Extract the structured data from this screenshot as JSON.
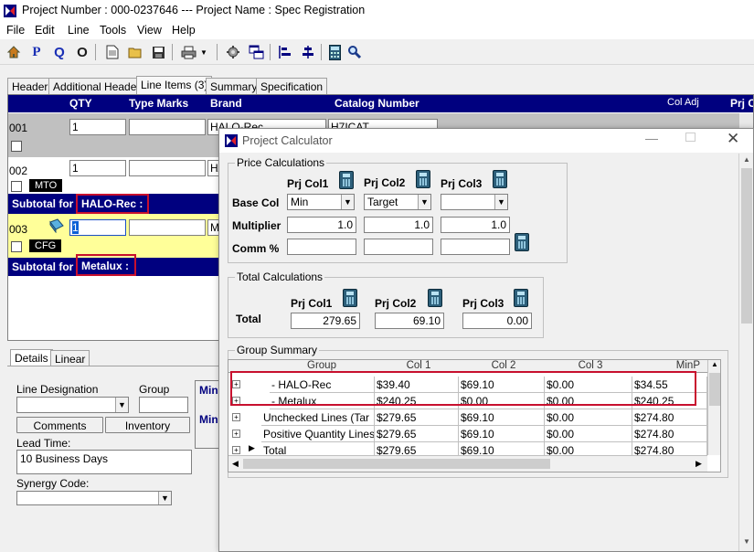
{
  "window": {
    "title": "Project Number : 000-0237646 --- Project Name : Spec Registration"
  },
  "menu": [
    "File",
    "Edit",
    "Line",
    "Tools",
    "View",
    "Help"
  ],
  "toolbar": {
    "icons": [
      "home-icon",
      "p-icon",
      "q-icon",
      "o-icon",
      "new-icon",
      "open-icon",
      "save-icon",
      "print-icon",
      "dropdown-icon",
      "gear-icon",
      "windows-icon",
      "align-left-icon",
      "align-center-icon",
      "calculator-icon",
      "search-icon"
    ],
    "p_label": "P",
    "q_label": "Q",
    "o_label": "O"
  },
  "tabs": [
    "Header",
    "Additional Header",
    "Line Items (3)",
    "Summary",
    "Specification"
  ],
  "grid": {
    "headers": [
      "QTY",
      "Type Marks",
      "Brand",
      "Catalog Number",
      "Col Adj",
      "Prj C"
    ],
    "rows": [
      {
        "num": "001",
        "qty": "1",
        "type_marks": "",
        "brand": "HALO-Rec",
        "catalog": "H7ICAT"
      },
      {
        "num": "002",
        "qty": "1",
        "type_marks": "",
        "brand": "HA",
        "tag": "MTO"
      },
      {
        "num": "003",
        "qty": "1",
        "type_marks": "",
        "brand": "Me",
        "tag": "CFG"
      }
    ],
    "subtotals": [
      {
        "label": "Subtotal for",
        "name": "HALO-Rec :"
      },
      {
        "label": "Subtotal for",
        "name": "Metalux :"
      }
    ]
  },
  "bottom": {
    "tabs": [
      "Details",
      "Linear"
    ],
    "line_designation_label": "Line Designation",
    "group_label": "Group",
    "comments_button": "Comments",
    "inventory_button": "Inventory",
    "lead_time_label": "Lead Time:",
    "lead_time_value": "10 Business Days",
    "synergy_label": "Synergy Code:",
    "side_labels": [
      "Min",
      "Min"
    ]
  },
  "dialog": {
    "title": "Project Calculator",
    "price_calc": {
      "legend": "Price Calculations",
      "col_headers": [
        "Prj Col1",
        "Prj Col2",
        "Prj Col3"
      ],
      "base_col_label": "Base Col",
      "base_col_values": [
        "Min",
        "Target",
        ""
      ],
      "multiplier_label": "Multiplier",
      "multiplier_values": [
        "1.0",
        "1.0",
        "1.0"
      ],
      "comm_label": "Comm %",
      "comm_values": [
        "",
        "",
        ""
      ]
    },
    "total_calc": {
      "legend": "Total Calculations",
      "col_headers": [
        "Prj Col1",
        "Prj Col2",
        "Prj Col3"
      ],
      "total_label": "Total",
      "total_values": [
        "279.65",
        "69.10",
        "0.00"
      ]
    },
    "group_summary": {
      "legend": "Group Summary",
      "headers": [
        "Group",
        "Col 1",
        "Col 2",
        "Col 3",
        "MinP"
      ],
      "rows": [
        {
          "group": "- HALO-Rec",
          "c1": "$39.40",
          "c2": "$69.10",
          "c3": "$0.00",
          "c4": "$34.55"
        },
        {
          "group": "- Metalux",
          "c1": "$240.25",
          "c2": "$0.00",
          "c3": "$0.00",
          "c4": "$240.25"
        },
        {
          "group": "Unchecked Lines (Tar",
          "c1": "$279.65",
          "c2": "$69.10",
          "c3": "$0.00",
          "c4": "$274.80"
        },
        {
          "group": "Positive Quantity Lines",
          "c1": "$279.65",
          "c2": "$69.10",
          "c3": "$0.00",
          "c4": "$274.80"
        },
        {
          "group": "Total",
          "c1": "$279.65",
          "c2": "$69.10",
          "c3": "$0.00",
          "c4": "$274.80"
        }
      ]
    }
  },
  "colors": {
    "header_navy": "#00007f",
    "highlight_red": "#c8102e",
    "row_yellow": "#ffff99",
    "row_gray": "#c0c0c0"
  }
}
